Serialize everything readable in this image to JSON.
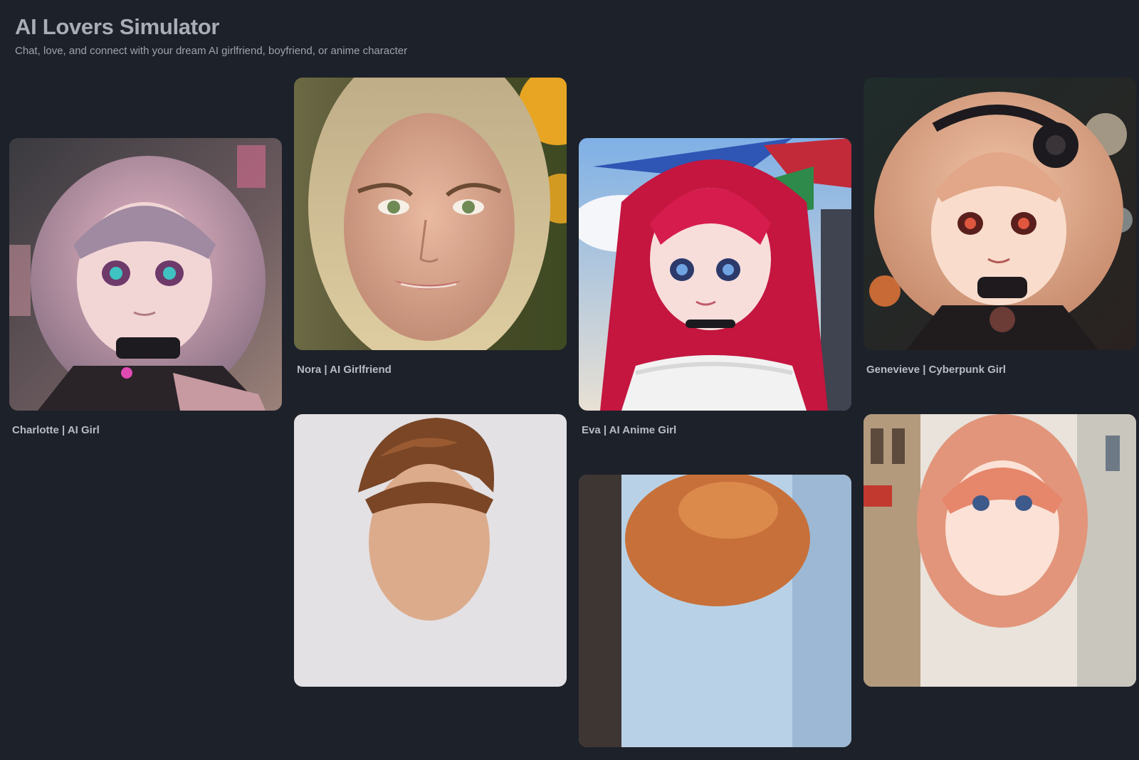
{
  "header": {
    "title": "AI Lovers Simulator",
    "subtitle": "Chat, love, and connect with your dream AI girlfriend, boyfriend, or anime character"
  },
  "cards": [
    {
      "name": "Charlotte | AI Girl"
    },
    {
      "name": "Nora | AI Girlfriend"
    },
    {
      "name": "Eva | AI Anime Girl"
    },
    {
      "name": "Genevieve | Cyberpunk Girl"
    },
    {
      "name": ""
    },
    {
      "name": ""
    },
    {
      "name": ""
    }
  ]
}
